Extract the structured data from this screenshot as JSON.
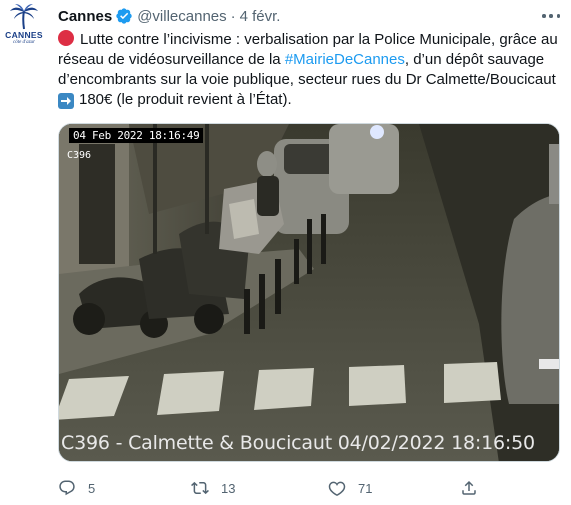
{
  "author": {
    "display_name": "Cannes",
    "handle": "@villecannes",
    "separator": "·",
    "date": "4 févr.",
    "logo_text": "CANNES",
    "logo_subtext": "côte d'azur",
    "verified": true
  },
  "tweet": {
    "line1": "Lutte contre l’incivisme : verbalisation par la Police Municipale, grâce au",
    "line2_before": "réseau de vidéosurveillance de la ",
    "hashtag": "#MairieDeCannes",
    "line2_after": ", d’un dépôt sauvage",
    "line3": "d’encombrants sur la voie publique, secteur rues du Dr Calmette/Boucicaut",
    "line4": "180€ (le produit revient à l’État).",
    "emoji_start": "red-circle",
    "emoji_arrow": "right-arrow"
  },
  "media": {
    "cam_timestamp": "04 Feb 2022   18:16:49",
    "cam_id": "C396",
    "caption": "C396 - Calmette & Boucicaut 04/02/2022 18:16:50"
  },
  "actions": {
    "replies": "5",
    "retweets": "13",
    "likes": "71"
  },
  "colors": {
    "text": "#0f1419",
    "secondary": "#536471",
    "link": "#1d9bf0",
    "verified": "#1d9bf0",
    "brand": "#1a3f87"
  },
  "icons": [
    "more-icon",
    "verified-icon",
    "reply-icon",
    "retweet-icon",
    "like-icon",
    "share-icon"
  ]
}
